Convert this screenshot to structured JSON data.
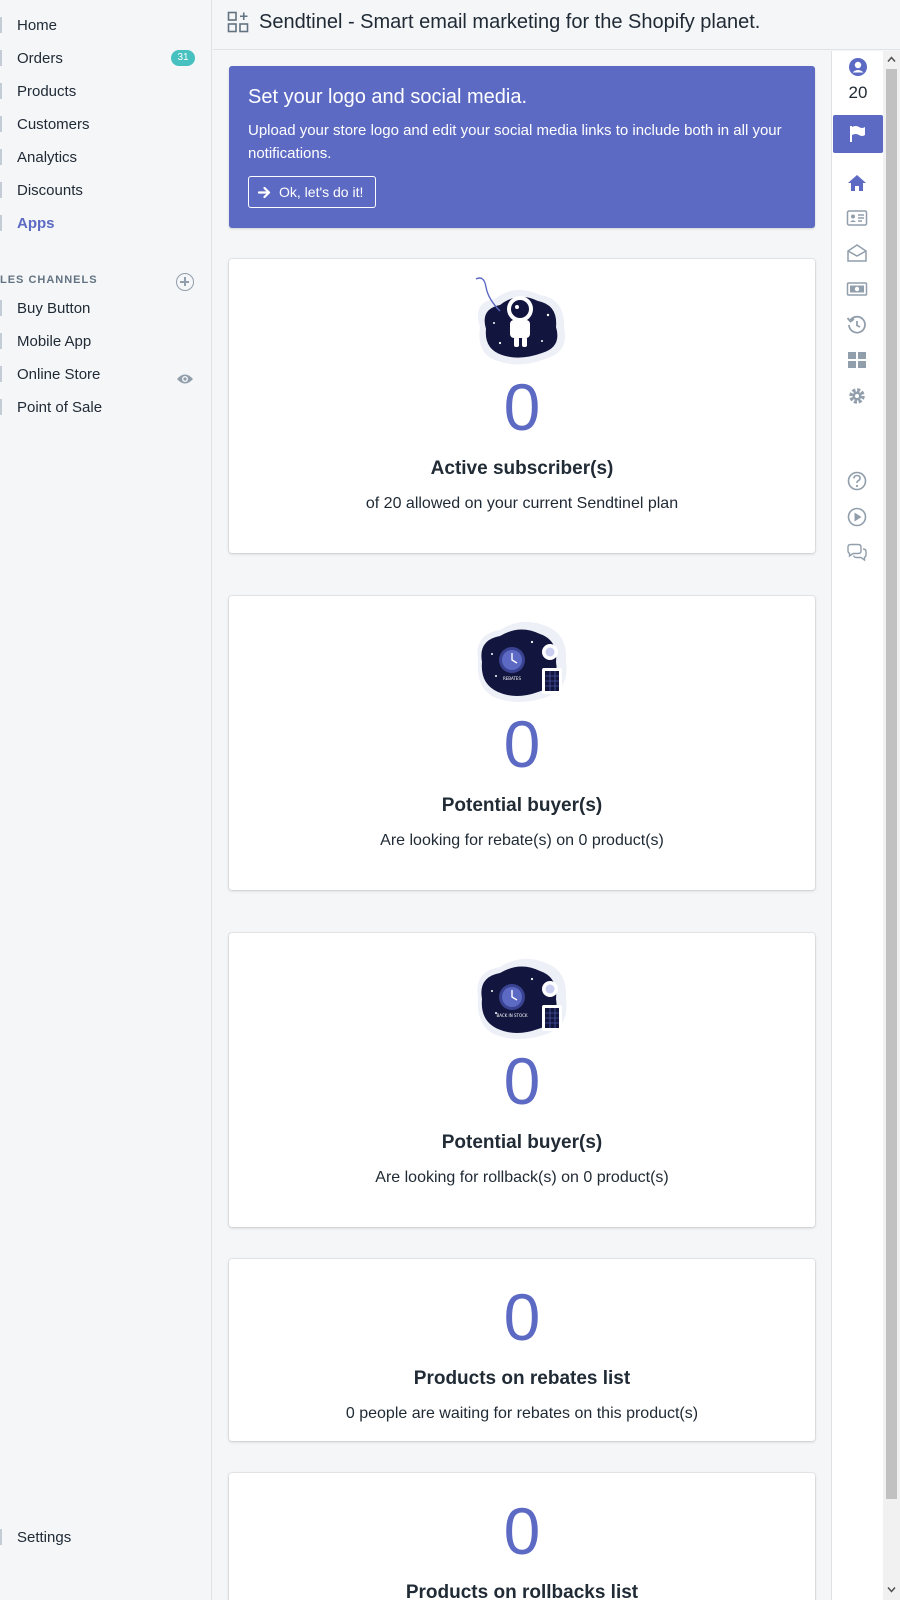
{
  "sidebar": {
    "items": [
      {
        "label": "Home",
        "active": false
      },
      {
        "label": "Orders",
        "badge": "31",
        "active": false
      },
      {
        "label": "Products",
        "active": false
      },
      {
        "label": "Customers",
        "active": false
      },
      {
        "label": "Analytics",
        "active": false
      },
      {
        "label": "Discounts",
        "active": false
      },
      {
        "label": "Apps",
        "active": true
      }
    ],
    "sales_channels_title": "LES CHANNELS",
    "channels": [
      {
        "label": "Buy Button"
      },
      {
        "label": "Mobile App"
      },
      {
        "label": "Online Store"
      },
      {
        "label": "Point of Sale"
      }
    ],
    "settings_label": "Settings"
  },
  "header": {
    "title": "Sendtinel - Smart email marketing for the Shopify planet."
  },
  "rail": {
    "subscriber_count": "20",
    "icons": [
      "user-circle-icon",
      "flag-icon",
      "home-icon",
      "contact-card-icon",
      "envelope-open-icon",
      "money-icon",
      "history-icon",
      "dashboard-grid-icon",
      "gear-icon",
      "help-icon",
      "play-icon",
      "chat-icon"
    ]
  },
  "banner": {
    "title": "Set your logo and social media.",
    "body": "Upload your store logo and edit your social media links to include both in all your notifications.",
    "button_label": "Ok, let's do it!"
  },
  "cards": [
    {
      "value": "0",
      "title": "Active subscriber(s)",
      "subtitle": "of 20 allowed on your current Sendtinel plan",
      "illustration": "astronaut-illustration"
    },
    {
      "value": "0",
      "title": "Potential buyer(s)",
      "subtitle": "Are looking for rebate(s) on 0 product(s)",
      "illustration": "rebates-illustration",
      "illustration_text": "REBATES"
    },
    {
      "value": "0",
      "title": "Potential buyer(s)",
      "subtitle": "Are looking for rollback(s) on 0 product(s)",
      "illustration": "back-in-stock-illustration",
      "illustration_text": "BACK IN STOCK"
    },
    {
      "value": "0",
      "title": "Products on rebates list",
      "subtitle": "0 people are waiting for rebates on this product(s)"
    },
    {
      "value": "0",
      "title": "Products on rollbacks list"
    }
  ],
  "colors": {
    "accent": "#5c6ac4",
    "badge": "#47c1bf",
    "background": "#f4f6f8",
    "text": "#212b36"
  }
}
